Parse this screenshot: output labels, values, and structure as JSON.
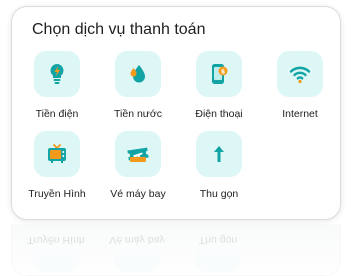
{
  "panel": {
    "title": "Chọn dịch vụ thanh toán"
  },
  "services": [
    {
      "label": "Tiền điện",
      "icon": "electricity-bolt-icon"
    },
    {
      "label": "Tiền nước",
      "icon": "water-drop-icon"
    },
    {
      "label": "Điện thoại",
      "icon": "phone-topup-icon"
    },
    {
      "label": "Internet",
      "icon": "wifi-icon"
    },
    {
      "label": "Truyền Hình",
      "icon": "tv-icon"
    },
    {
      "label": "Vé máy bay",
      "icon": "plane-ticket-icon"
    },
    {
      "label": "Thu gọn",
      "icon": "arrow-up-icon"
    }
  ],
  "colors": {
    "tile_bg": "#ddf6f6",
    "accent_teal": "#0fa3a3",
    "accent_orange": "#f39a1d",
    "text": "#1d1f21"
  }
}
